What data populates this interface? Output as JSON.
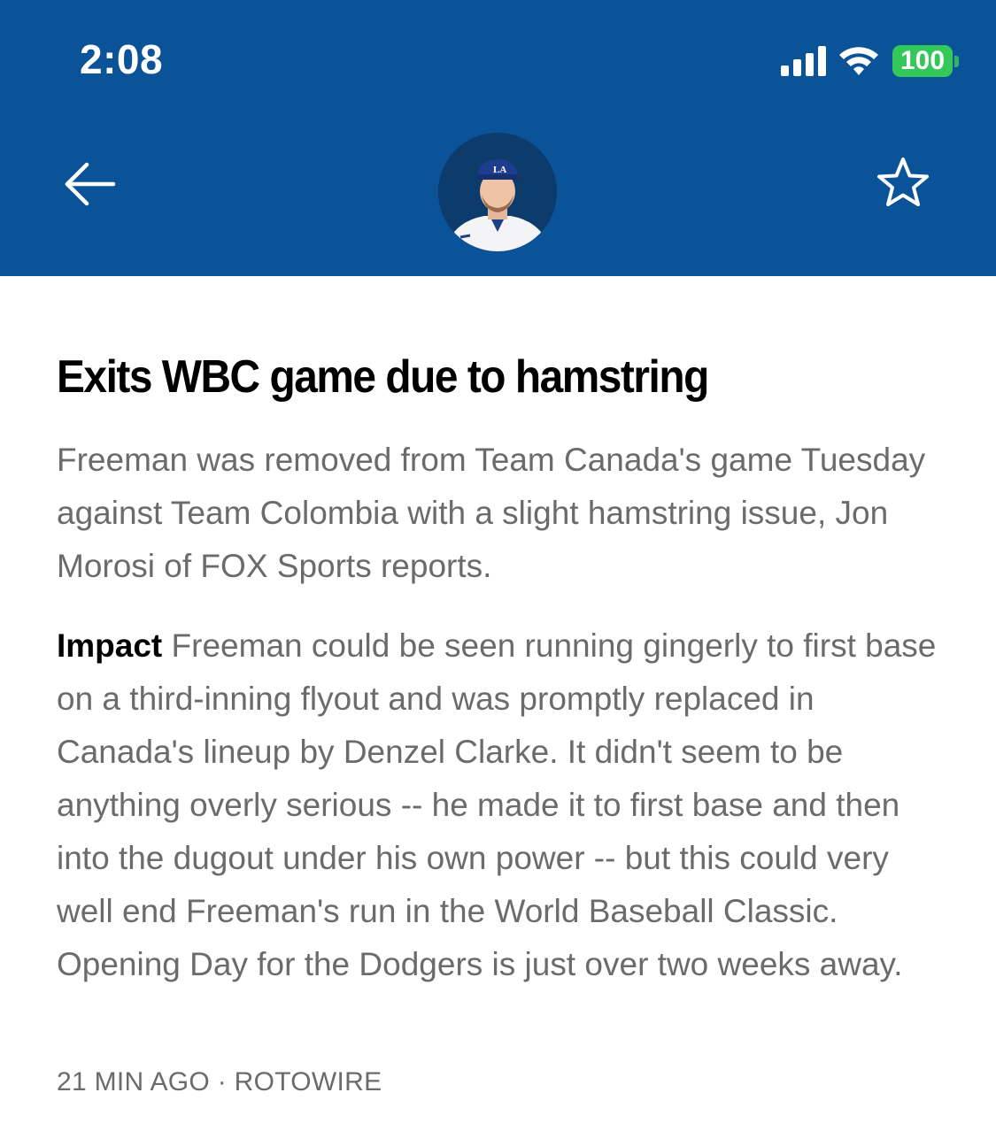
{
  "status_bar": {
    "time": "2:08",
    "battery": "100",
    "icons": [
      "cellular-signal-icon",
      "wifi-icon",
      "battery-icon"
    ]
  },
  "header": {
    "background_color": "#0b5399",
    "back_icon": "arrow-left-icon",
    "favorite_icon": "star-outline-icon",
    "avatar_icon": "player-headshot"
  },
  "article": {
    "headline": "Exits WBC game due to hamstring",
    "summary": "Freeman was removed from Team Canada's game Tuesday against Team Colombia with a slight hamstring issue, Jon Morosi of FOX Sports reports.",
    "impact_label": "Impact",
    "impact_text": "Freeman could be seen running gingerly to first base on a third-inning flyout and was promptly replaced in Canada's lineup by Denzel Clarke. It didn't seem to be anything overly serious -- he made it to first base and then into the dugout under his own power -- but this could very well end Freeman's run in the World Baseball Classic. Opening Day for the Dodgers is just over two weeks away.",
    "meta": "21 MIN AGO · ROTOWIRE"
  }
}
